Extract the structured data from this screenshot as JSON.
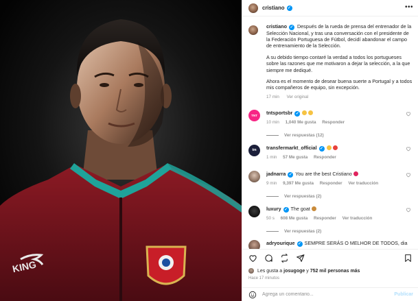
{
  "post": {
    "username": "cristiano",
    "photo_alt": "Cristiano Ronaldo in Portugal national team jacket",
    "jacket_text": "KING"
  },
  "caption": {
    "username": "cristiano",
    "paragraphs": [
      "Después de la rueda de prensa del entrenador de la Selección Nacional, y tras una conversación con el presidente de la Federación Portuguesa de Fútbol, decidí abandonar el campo de entrenamiento de la Selección.",
      "A su debido tiempo contaré la verdad a todos los portugueses sobre las razones que me motivaron a dejar la selección, a la que siempre me dediqué.",
      "Ahora es el momento de desear buena suerte a Portugal y a todos mis compañeros de equipo, sin excepción."
    ],
    "time": "17 min",
    "see_original": "Ver original"
  },
  "comments": [
    {
      "username": "tntsportsbr",
      "avatar_text": "TNT SPORTS",
      "text": "",
      "emojis": [
        "#f6c343",
        "#f6c343"
      ],
      "time": "10 min",
      "likes": "1,040 Me gusta",
      "reply": "Responder",
      "translate": "",
      "replies": "Ver respuestas (12)"
    },
    {
      "username": "transfermarkt_official",
      "avatar_text": "tm",
      "text": "",
      "emojis": [
        "#f6c343",
        "#e8413c"
      ],
      "time": "1 min",
      "likes": "57 Me gusta",
      "reply": "Responder",
      "translate": "",
      "replies": ""
    },
    {
      "username": "jadnarra",
      "avatar_text": "",
      "text": "You are the best Cristiano",
      "emojis": [
        "#e0245e"
      ],
      "time": "9 min",
      "likes": "9,397 Me gusta",
      "reply": "Responder",
      "translate": "Ver traducción",
      "replies": "Ver respuestas (2)"
    },
    {
      "username": "luxury",
      "avatar_text": "",
      "text": "The goat",
      "emojis": [
        "#c98b3b"
      ],
      "time": "50 s",
      "likes": "608 Me gusta",
      "reply": "Responder",
      "translate": "Ver traducción",
      "replies": "Ver respuestas (2)"
    },
    {
      "username": "adryourique",
      "avatar_text": "",
      "text": "SEMPRE SERÁS O MELHOR DE TODOS, dia",
      "emojis": [],
      "time": "",
      "likes": "",
      "reply": "",
      "translate": "",
      "replies": ""
    }
  ],
  "likes": {
    "prefix": "Les gusta a",
    "user": "josugoge",
    "connector": "y",
    "others": "752 mil personas más"
  },
  "time_ago": "Hace 17 minutos",
  "composer": {
    "placeholder": "Agrega un comentario...",
    "publish": "Publicar"
  },
  "colors": {
    "verified": "#0095f6",
    "publish_disabled": "#b2dffc",
    "jacket": "#7a1420",
    "collar": "#1fa39a"
  }
}
